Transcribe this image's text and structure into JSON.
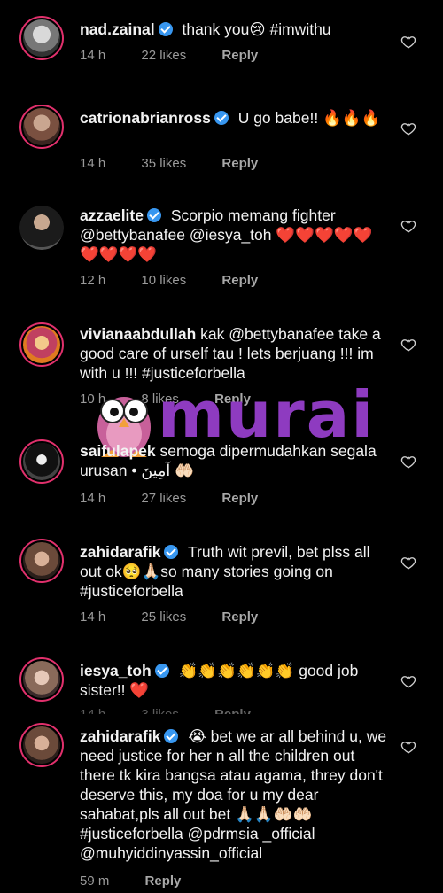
{
  "comments": [
    {
      "username": "nad.zainal",
      "verified": true,
      "text": "thank you😢 #imwithu",
      "time": "14 h",
      "likes": "22 likes",
      "reply": "Reply"
    },
    {
      "username": "catrionabrianross",
      "verified": true,
      "text": "U go babe!! 🔥🔥🔥",
      "time": "14 h",
      "likes": "35 likes",
      "reply": "Reply"
    },
    {
      "username": "azzaelite",
      "verified": true,
      "text": "Scorpio memang fighter @bettybanafee @iesya_toh ❤️❤️❤️❤️❤️❤️❤️❤️❤️",
      "time": "12 h",
      "likes": "10 likes",
      "reply": "Reply"
    },
    {
      "username": "vivianaabdullah",
      "verified": false,
      "text": "kak @bettybanafee take a good care of urself  tau ! lets berjuang !!! im with u !!! #justiceforbella",
      "time": "10 h",
      "likes": "8 likes",
      "reply": "Reply"
    },
    {
      "username": "saifulapek",
      "verified": false,
      "text": "semoga dipermudahkan segala urusan • آمِينَ 🤲🏻",
      "time": "14 h",
      "likes": "27 likes",
      "reply": "Reply"
    },
    {
      "username": "zahidarafik",
      "verified": true,
      "text": "Truth wit previl, bet plss all out ok🥺🙏🏻so many stories going on #justiceforbella",
      "time": "14 h",
      "likes": "25 likes",
      "reply": "Reply"
    },
    {
      "username": "iesya_toh",
      "verified": true,
      "text": "👏👏👏👏👏👏 good job sister!! ❤️",
      "time": "14 h",
      "likes": "3 likes",
      "reply": "Reply"
    },
    {
      "username": "zahidarafik",
      "verified": true,
      "text": "😭 bet we ar all behind u, we need justice for her n all the children out there tk kira bangsa atau agama, threy don't deserve this, my doa for u my dear sahabat,pls all out bet 🙏🏻🙏🏻🤲🏻🤲🏻 #justiceforbella @pdrmsia _official @muhyiddinyassin_official",
      "time": "59 m",
      "likes": "",
      "reply": "Reply"
    }
  ],
  "watermark": {
    "text": "murai"
  },
  "colors": {
    "accent": "#e1306c",
    "verified": "#3897f0",
    "heart_red": "#e0245e",
    "watermark": "#8e3bc0"
  }
}
